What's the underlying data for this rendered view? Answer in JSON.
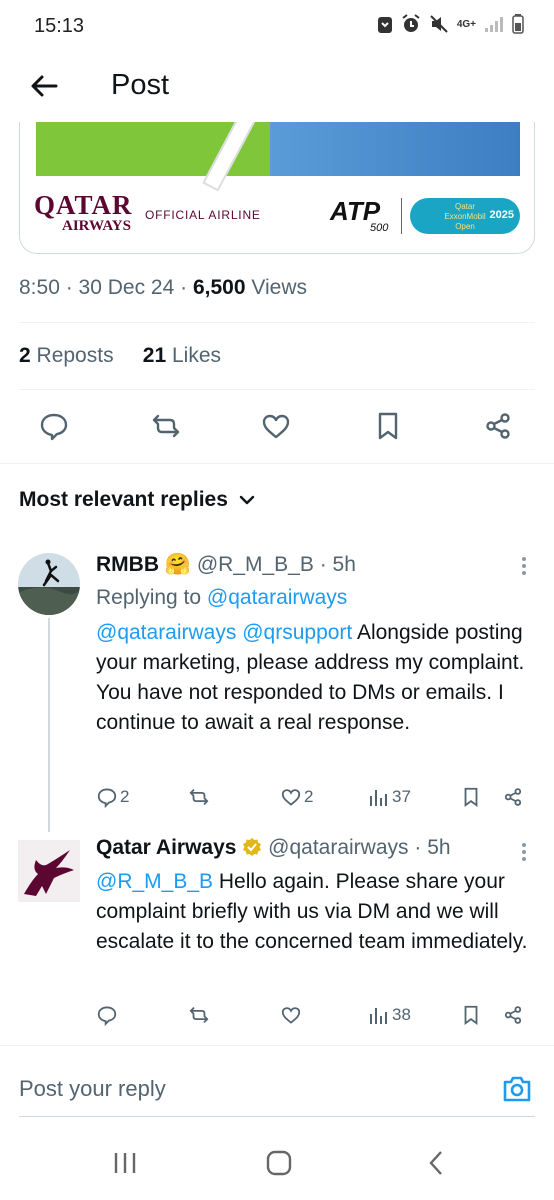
{
  "status": {
    "time": "15:13",
    "network": "4G+"
  },
  "header": {
    "title": "Post"
  },
  "media": {
    "airline": "QATAR",
    "airline_sub": "AIRWAYS",
    "official": "OFFICIAL AIRLINE",
    "atp": "ATP",
    "atp_level": "500",
    "badge_line1": "Qatar",
    "badge_line2": "ExxonMobil",
    "badge_line3": "Open",
    "badge_year": "2025"
  },
  "meta": {
    "time": "8:50",
    "date": "30 Dec 24",
    "views_count": "6,500",
    "views_label": "Views"
  },
  "stats": {
    "reposts_count": "2",
    "reposts_label": "Reposts",
    "likes_count": "21",
    "likes_label": "Likes"
  },
  "replies_filter": "Most relevant replies",
  "replies": [
    {
      "name": "RMBB",
      "handle": "@R_M_B_B",
      "time": "5h",
      "replying_to_label": "Replying to",
      "replying_to": "@qatarairways",
      "mention1": "@qatarairways",
      "mention2": "@qrsupport",
      "text": " Alongside posting your marketing, please address my complaint. You have not responded to DMs or emails. I continue to await a real response.",
      "replies_count": "2",
      "likes_count": "2",
      "views_count": "37"
    },
    {
      "name": "Qatar Airways",
      "handle": "@qatarairways",
      "time": "5h",
      "mention1": "@R_M_B_B",
      "text": " Hello again. Please share your complaint briefly with us via DM and we will escalate it to the concerned team immediately.",
      "views_count": "38"
    }
  ],
  "composer": {
    "placeholder": "Post your reply"
  },
  "colors": {
    "accent": "#1d9bf0",
    "qatar_maroon": "#5c0632",
    "text": "#0f1419",
    "muted": "#536471"
  }
}
